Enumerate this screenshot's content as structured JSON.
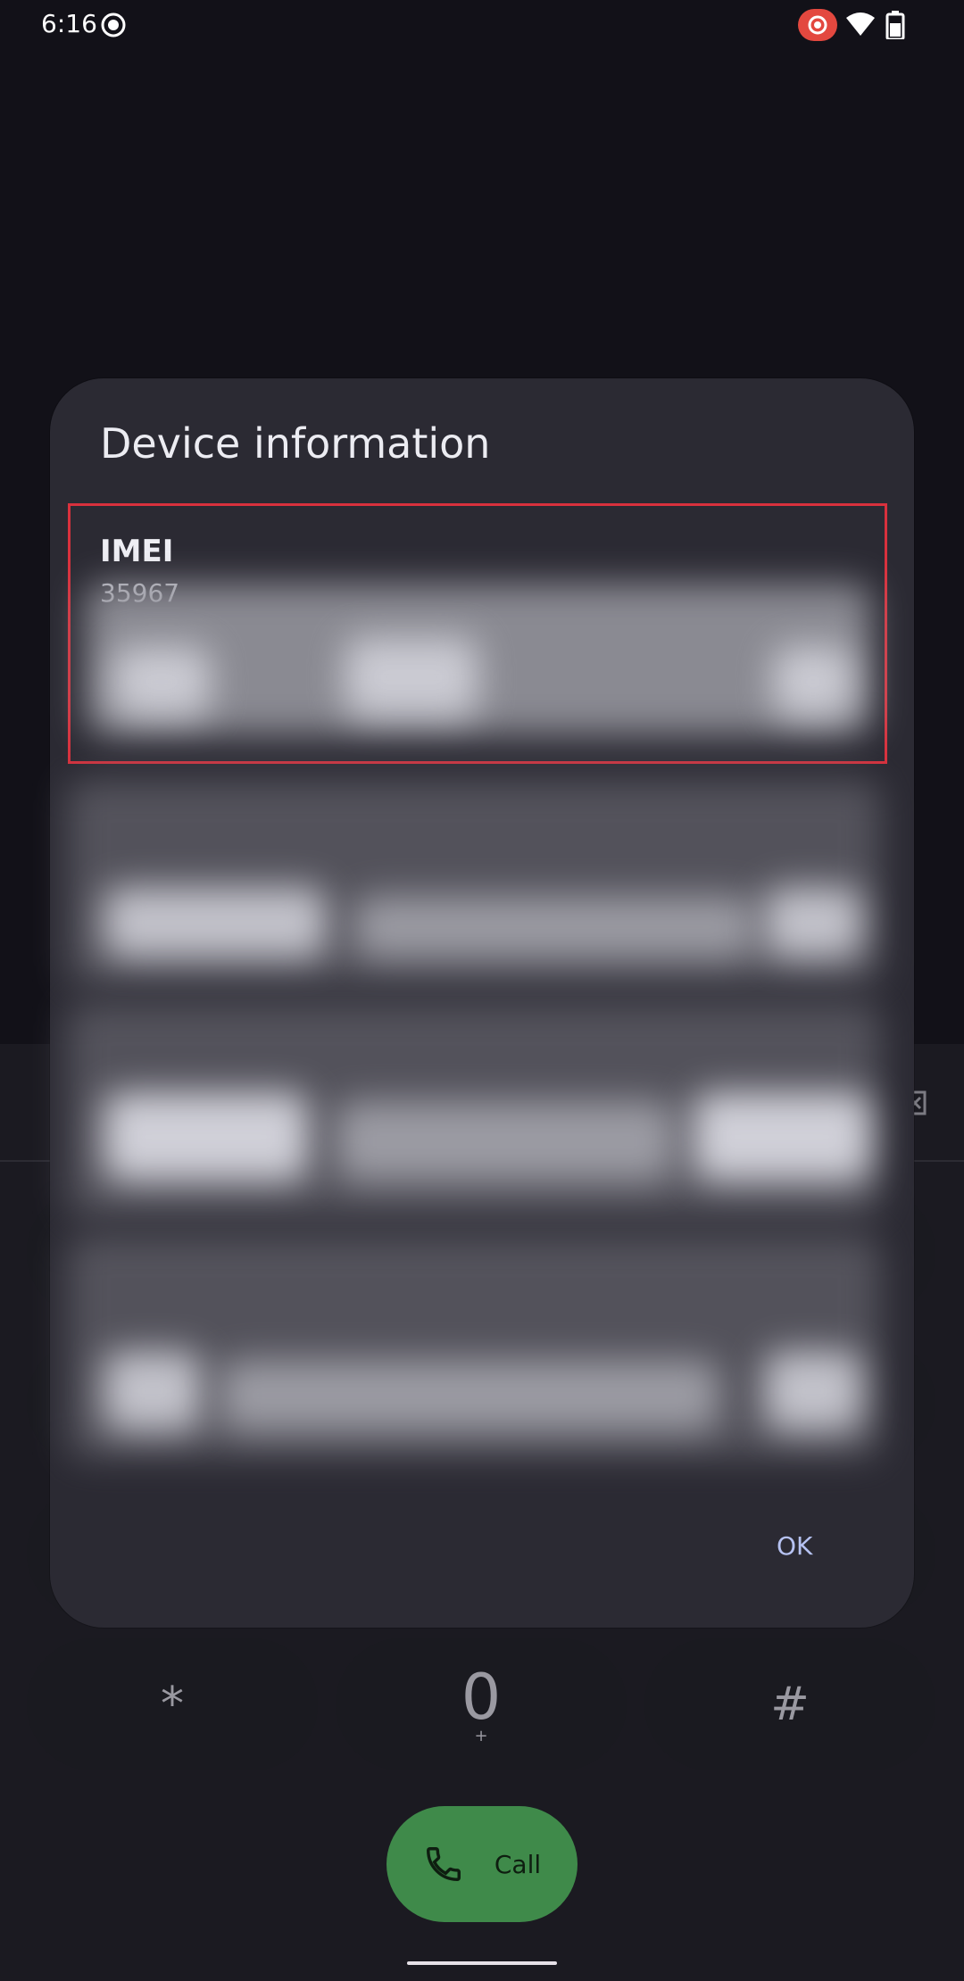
{
  "status_bar": {
    "time": "6:16"
  },
  "dialog": {
    "title": "Device information",
    "rows": [
      {
        "label": "IMEI",
        "value_partial": "35967"
      }
    ],
    "ok_label": "OK"
  },
  "dialer": {
    "keys": [
      {
        "main": "*",
        "sub": ""
      },
      {
        "main": "0",
        "sub": "+"
      },
      {
        "main": "#",
        "sub": ""
      }
    ],
    "call_label": "Call"
  },
  "colors": {
    "dialog_bg": "#2b2a33",
    "highlight": "#d9313d",
    "call_button": "#3f8a4a",
    "ok_text": "#b6c2f2"
  },
  "icons": [
    "screen-record-icon",
    "cast-icon",
    "wifi-icon",
    "battery-icon",
    "backspace-icon",
    "phone-icon"
  ]
}
